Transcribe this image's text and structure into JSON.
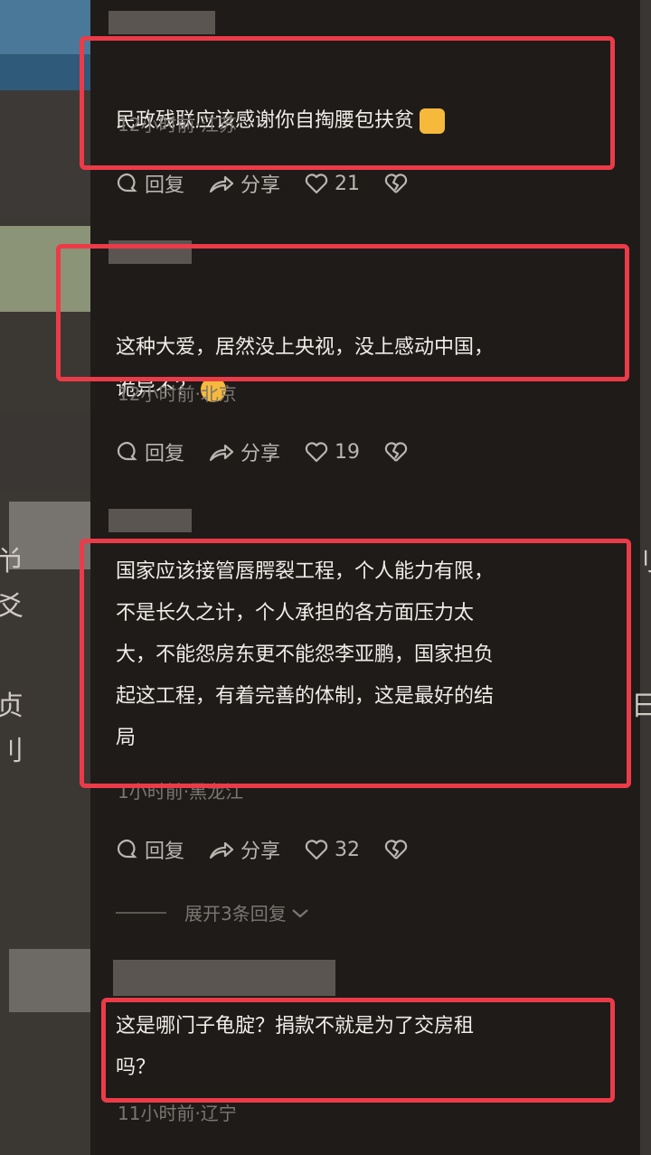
{
  "comments": [
    {
      "text": "民政残联应该感谢你自掏腰包扶贫",
      "meta": "12小时前·江苏",
      "reply": "回复",
      "share": "分享",
      "likes": "21"
    },
    {
      "text": "这种大爱，居然没上央视，没上感动中国，\n诡异不？",
      "meta": "12小时前·北京",
      "reply": "回复",
      "share": "分享",
      "likes": "19"
    },
    {
      "text": "国家应该接管唇腭裂工程，个人能力有限，\n不是长久之计，个人承担的各方面压力太\n大，不能怨房东更不能怨李亚鹏，国家担负\n起这工程，有着完善的体制，这是最好的结\n局",
      "meta": "1小时前·黑龙江",
      "reply": "回复",
      "share": "分享",
      "likes": "32",
      "expand": "展开3条回复"
    },
    {
      "text": "这是哪门子龟腚？捐款不就是为了交房租\n吗？",
      "meta": "11小时前·辽宁"
    }
  ],
  "colors": {
    "highlight": "#ec3b48",
    "background": "#1f1b19",
    "text": "#f0ece8",
    "meta": "#7a7672"
  },
  "icons": [
    "comment-icon",
    "share-icon",
    "heart-icon",
    "broken-heart-icon",
    "chevron-down-icon",
    "thumbs-up-emoji",
    "laughing-crying-emoji"
  ]
}
